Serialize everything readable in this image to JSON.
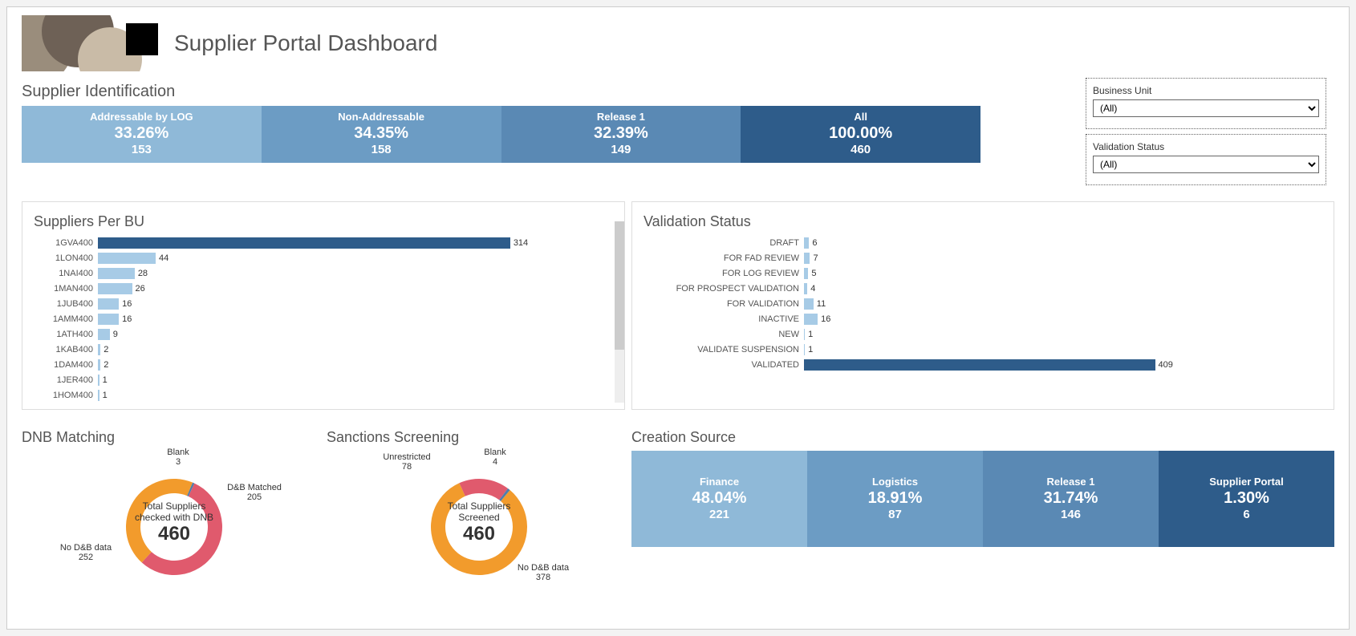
{
  "title": "Supplier Portal Dashboard",
  "filters": {
    "bu_label": "Business Unit",
    "bu_value": "(All)",
    "vs_label": "Validation Status",
    "vs_value": "(All)"
  },
  "identification": {
    "section": "Supplier Identification",
    "cards": [
      {
        "label": "Addressable by LOG",
        "pct": "33.26%",
        "count": "153",
        "color": "#8fb9d8"
      },
      {
        "label": "Non-Addressable",
        "pct": "34.35%",
        "count": "158",
        "color": "#6c9cc4"
      },
      {
        "label": "Release 1",
        "pct": "32.39%",
        "count": "149",
        "color": "#5a89b4"
      },
      {
        "label": "All",
        "pct": "100.00%",
        "count": "460",
        "color": "#2e5c8a"
      }
    ]
  },
  "suppliers_per_bu": {
    "section": "Suppliers Per BU"
  },
  "validation_status": {
    "section": "Validation Status"
  },
  "dnb": {
    "section": "DNB Matching",
    "center_label": "Total Suppliers checked with DNB",
    "center_value": "460"
  },
  "sanctions": {
    "section": "Sanctions Screening",
    "center_label": "Total Suppliers Screened",
    "center_value": "460"
  },
  "creation": {
    "section": "Creation Source",
    "cards": [
      {
        "label": "Finance",
        "pct": "48.04%",
        "count": "221",
        "color": "#8fb9d8"
      },
      {
        "label": "Logistics",
        "pct": "18.91%",
        "count": "87",
        "color": "#6c9cc4"
      },
      {
        "label": "Release 1",
        "pct": "31.74%",
        "count": "146",
        "color": "#5a89b4"
      },
      {
        "label": "Supplier Portal",
        "pct": "1.30%",
        "count": "6",
        "color": "#2e5c8a"
      }
    ]
  },
  "chart_data": [
    {
      "name": "supplier_identification_kpis",
      "type": "table",
      "categories": [
        "Addressable by LOG",
        "Non-Addressable",
        "Release 1",
        "All"
      ],
      "series": [
        {
          "name": "percent",
          "values": [
            33.26,
            34.35,
            32.39,
            100.0
          ]
        },
        {
          "name": "count",
          "values": [
            153,
            158,
            149,
            460
          ]
        }
      ]
    },
    {
      "name": "suppliers_per_bu",
      "type": "bar",
      "orientation": "horizontal",
      "title": "Suppliers Per BU",
      "xlabel": "",
      "ylabel": "",
      "xlim": [
        0,
        330
      ],
      "categories": [
        "1GVA400",
        "1LON400",
        "1NAI400",
        "1MAN400",
        "1JUB400",
        "1AMM400",
        "1ATH400",
        "1KAB400",
        "1DAM400",
        "1JER400",
        "1HOM400"
      ],
      "values": [
        314,
        44,
        28,
        26,
        16,
        16,
        9,
        2,
        2,
        1,
        1
      ],
      "bar_colors": [
        "#2e5c8a",
        "#a7cbe6",
        "#a7cbe6",
        "#a7cbe6",
        "#a7cbe6",
        "#a7cbe6",
        "#a7cbe6",
        "#a7cbe6",
        "#a7cbe6",
        "#a7cbe6",
        "#a7cbe6"
      ]
    },
    {
      "name": "validation_status",
      "type": "bar",
      "orientation": "horizontal",
      "title": "Validation Status",
      "xlabel": "",
      "ylabel": "",
      "xlim": [
        0,
        430
      ],
      "categories": [
        "DRAFT",
        "FOR FAD REVIEW",
        "FOR LOG REVIEW",
        "FOR PROSPECT VALIDATION",
        "FOR VALIDATION",
        "INACTIVE",
        "NEW",
        "VALIDATE SUSPENSION",
        "VALIDATED"
      ],
      "values": [
        6,
        7,
        5,
        4,
        11,
        16,
        1,
        1,
        409
      ],
      "bar_colors": [
        "#a7cbe6",
        "#a7cbe6",
        "#a7cbe6",
        "#a7cbe6",
        "#a7cbe6",
        "#a7cbe6",
        "#a7cbe6",
        "#a7cbe6",
        "#2e5c8a"
      ]
    },
    {
      "name": "dnb_matching",
      "type": "pie",
      "title": "DNB Matching",
      "categories": [
        "No D&B data",
        "D&B Matched",
        "Blank"
      ],
      "values": [
        252,
        205,
        3
      ],
      "colors": [
        "#e05a6d",
        "#f29b2c",
        "#4f7dab"
      ],
      "center_label": "Total Suppliers checked with DNB",
      "center_value": 460
    },
    {
      "name": "sanctions_screening",
      "type": "pie",
      "title": "Sanctions Screening",
      "categories": [
        "No D&B data",
        "Unrestricted",
        "Blank"
      ],
      "values": [
        378,
        78,
        4
      ],
      "colors": [
        "#f29b2c",
        "#e05a6d",
        "#4f7dab"
      ],
      "center_label": "Total Suppliers Screened",
      "center_value": 460
    },
    {
      "name": "creation_source",
      "type": "table",
      "categories": [
        "Finance",
        "Logistics",
        "Release 1",
        "Supplier Portal"
      ],
      "series": [
        {
          "name": "percent",
          "values": [
            48.04,
            18.91,
            31.74,
            1.3
          ]
        },
        {
          "name": "count",
          "values": [
            221,
            87,
            146,
            6
          ]
        }
      ]
    }
  ]
}
